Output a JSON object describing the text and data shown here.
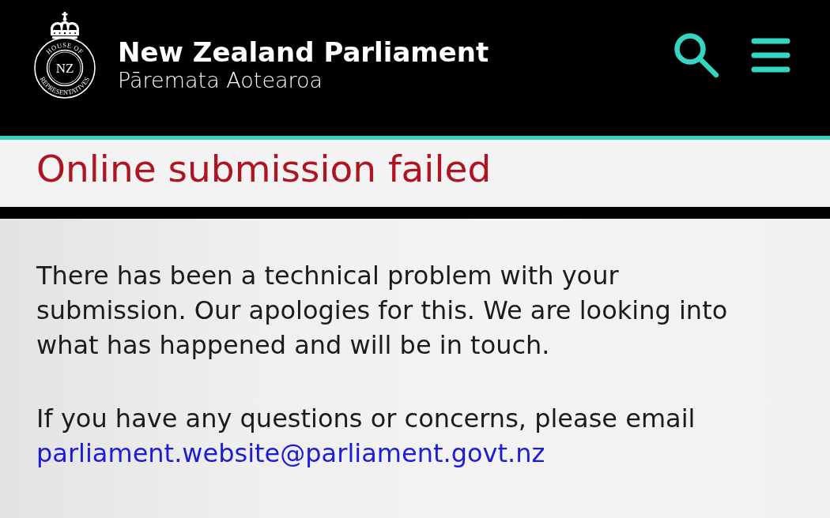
{
  "header": {
    "logo": {
      "monogram": "NZ",
      "ring_top": "HOUSE OF",
      "ring_bottom": "REPRESENTATIVES"
    },
    "title": "New Zealand Parliament",
    "subtitle": "Pāremata Aotearoa"
  },
  "page_title": "Online submission failed",
  "content": {
    "paragraphs": [
      "There has been a technical problem with your submission. Our apologies for this. We are looking into what has happened and will be in touch."
    ],
    "contact": {
      "text": "If you have any questions or concerns, please email",
      "email": "parliament.website@parliament.govt.nz"
    }
  }
}
